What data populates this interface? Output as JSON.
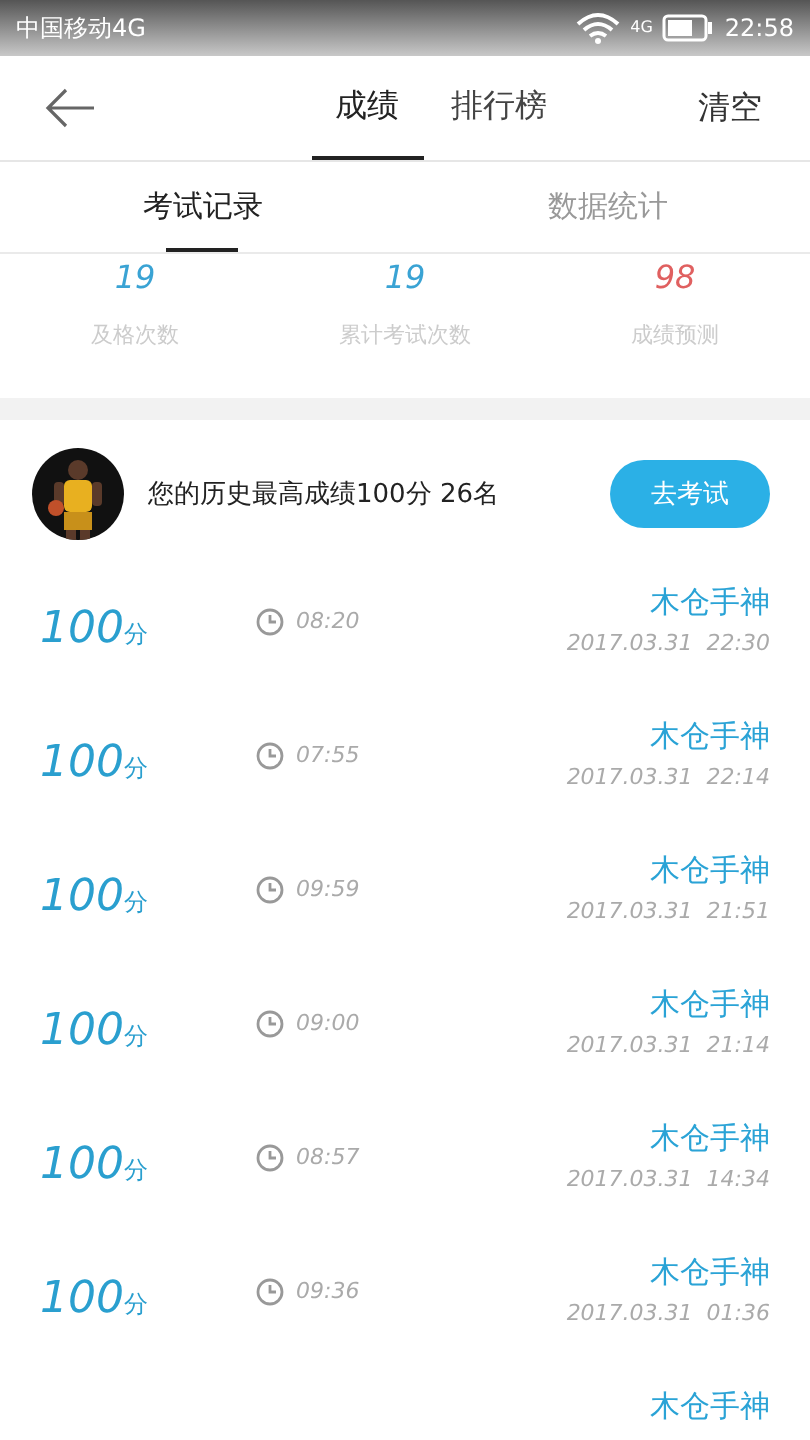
{
  "status_bar": {
    "carrier": "中国移动4G",
    "network": "4G",
    "time": "22:58"
  },
  "header": {
    "tabs": [
      {
        "label": "成绩",
        "selected": true
      },
      {
        "label": "排行榜",
        "selected": false
      }
    ],
    "action": "清空"
  },
  "sub_tabs": [
    {
      "label": "考试记录",
      "selected": true
    },
    {
      "label": "数据统计",
      "selected": false
    }
  ],
  "stats": [
    {
      "value": "19",
      "label": "及格次数",
      "color": "#3aa3d4"
    },
    {
      "value": "19",
      "label": "累计考试次数",
      "color": "#3aa3d4"
    },
    {
      "value": "98",
      "label": "成绩预测",
      "color": "#e06060"
    }
  ],
  "best": {
    "text": "您的历史最高成绩100分  26名",
    "button": "去考试"
  },
  "records": [
    {
      "score": "100",
      "unit": "分",
      "duration": "08:20",
      "title": "木仓手神",
      "date": "2017.03.31  22:30"
    },
    {
      "score": "100",
      "unit": "分",
      "duration": "07:55",
      "title": "木仓手神",
      "date": "2017.03.31  22:14"
    },
    {
      "score": "100",
      "unit": "分",
      "duration": "09:59",
      "title": "木仓手神",
      "date": "2017.03.31  21:51"
    },
    {
      "score": "100",
      "unit": "分",
      "duration": "09:00",
      "title": "木仓手神",
      "date": "2017.03.31  21:14"
    },
    {
      "score": "100",
      "unit": "分",
      "duration": "08:57",
      "title": "木仓手神",
      "date": "2017.03.31  14:34"
    },
    {
      "score": "100",
      "unit": "分",
      "duration": "09:36",
      "title": "木仓手神",
      "date": "2017.03.31  01:36"
    },
    {
      "title": "木仓手神"
    }
  ]
}
